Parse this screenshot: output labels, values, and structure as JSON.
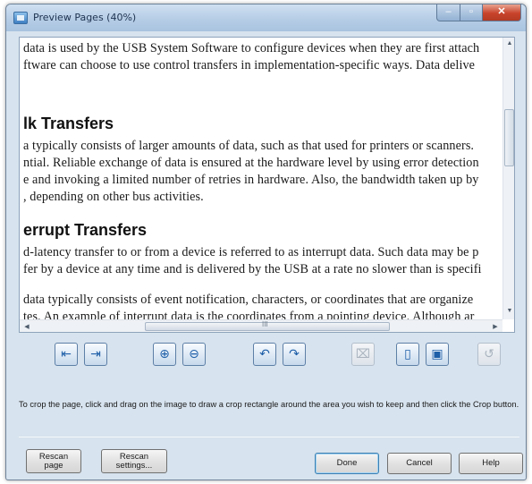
{
  "window": {
    "title": "Preview Pages  (40%)",
    "controls": {
      "minimize": "–",
      "maximize": "▫",
      "close": "✕"
    }
  },
  "document": {
    "lines": [
      "data is used by the USB System Software to configure devices when they are first attach",
      "ftware can choose to use control transfers in implementation-specific ways.  Data delive",
      "a typically consists of larger amounts of data, such as that used for printers or scanners.",
      "ntial.  Reliable exchange of data is ensured at the hardware level by using error detection",
      "e and invoking a limited number of retries in hardware.  Also, the bandwidth taken up by",
      ", depending on other bus activities.",
      "d-latency transfer to or from a device is referred to as interrupt data.  Such data may be p",
      "fer by a device at any time and is delivered by the USB at a rate no slower than is specifi",
      "data typically consists of event notification, characters, or coordinates that are organize",
      "tes.  An example of interrupt data is the coordinates from a pointing device.  Although ar"
    ],
    "headings": [
      "lk Transfers",
      "errupt Transfers"
    ]
  },
  "scrollbar": {
    "grip": "III"
  },
  "toolbar": {
    "buttons": [
      {
        "name": "rotate-left-icon",
        "glyph": "⇤",
        "enabled": true
      },
      {
        "name": "rotate-right-icon",
        "glyph": "⇥",
        "enabled": true
      },
      {
        "name": "zoom-in-icon",
        "glyph": "⊕",
        "enabled": true
      },
      {
        "name": "zoom-out-icon",
        "glyph": "⊖",
        "enabled": true
      },
      {
        "name": "rotate-counterclockwise-icon",
        "glyph": "↶",
        "enabled": true
      },
      {
        "name": "rotate-clockwise-icon",
        "glyph": "↷",
        "enabled": true
      },
      {
        "name": "crop-icon",
        "glyph": "⌧",
        "enabled": false
      },
      {
        "name": "page-icon",
        "glyph": "▯",
        "enabled": true
      },
      {
        "name": "page-settings-icon",
        "glyph": "▣",
        "enabled": true
      },
      {
        "name": "undo-icon",
        "glyph": "↺",
        "enabled": false
      }
    ]
  },
  "hint": "To crop the page, click and drag on the image to draw a crop rectangle around the area you wish to keep and then click the Crop button.",
  "buttons": {
    "rescan_page": "Rescan\npage",
    "rescan_settings": "Rescan\nsettings...",
    "done": "Done",
    "cancel": "Cancel",
    "help": "Help"
  }
}
